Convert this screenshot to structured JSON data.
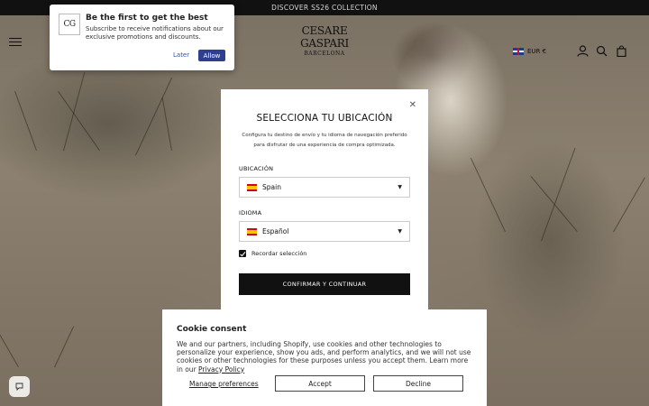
{
  "announcement": {
    "text": "DISCOVER SS26 COLLECTION"
  },
  "header": {
    "brand_name": "CESARE GASPARI",
    "brand_city": "BARCELONA",
    "currency_label": "EUR €"
  },
  "push_prompt": {
    "logo_text": "CG",
    "title": "Be the first to get the best",
    "text": "Subscribe to receive notifications about our exclusive promotions and discounts.",
    "later_label": "Later",
    "allow_label": "Allow"
  },
  "location_modal": {
    "title": "SELECCIONA TU UBICACIÓN",
    "description": "Configura tu destino de envío y tu idioma de navegación preferido para disfrutar de una experiencia de compra optimizada.",
    "location_label": "UBICACIÓN",
    "location_value": "Spain",
    "language_label": "IDIOMA",
    "language_value": "Español",
    "remember_label": "Recordar selección",
    "confirm_label": "CONFIRMAR Y CONTINUAR"
  },
  "cookie_consent": {
    "title": "Cookie consent",
    "text": "We and our partners, including Shopify, use cookies and other technologies to personalize your experience, show you ads, and perform analytics, and we will not use cookies or other technologies for these purposes unless you accept them. Learn more in our ",
    "privacy_link": "Privacy Policy",
    "manage_label": "Manage preferences",
    "accept_label": "Accept",
    "decline_label": "Decline"
  },
  "icons": {
    "menu": "menu-icon",
    "flag_uk": "uk-flag-icon",
    "account": "account-icon",
    "search": "search-icon",
    "bag": "bag-icon",
    "close": "close-icon",
    "flag_es": "spain-flag-icon",
    "chevron": "chevron-down-icon",
    "checkbox": "checkbox-checked-icon",
    "chat": "chat-icon"
  },
  "colors": {
    "accent_button": "#2f3f8f",
    "confirm_button": "#111111"
  }
}
